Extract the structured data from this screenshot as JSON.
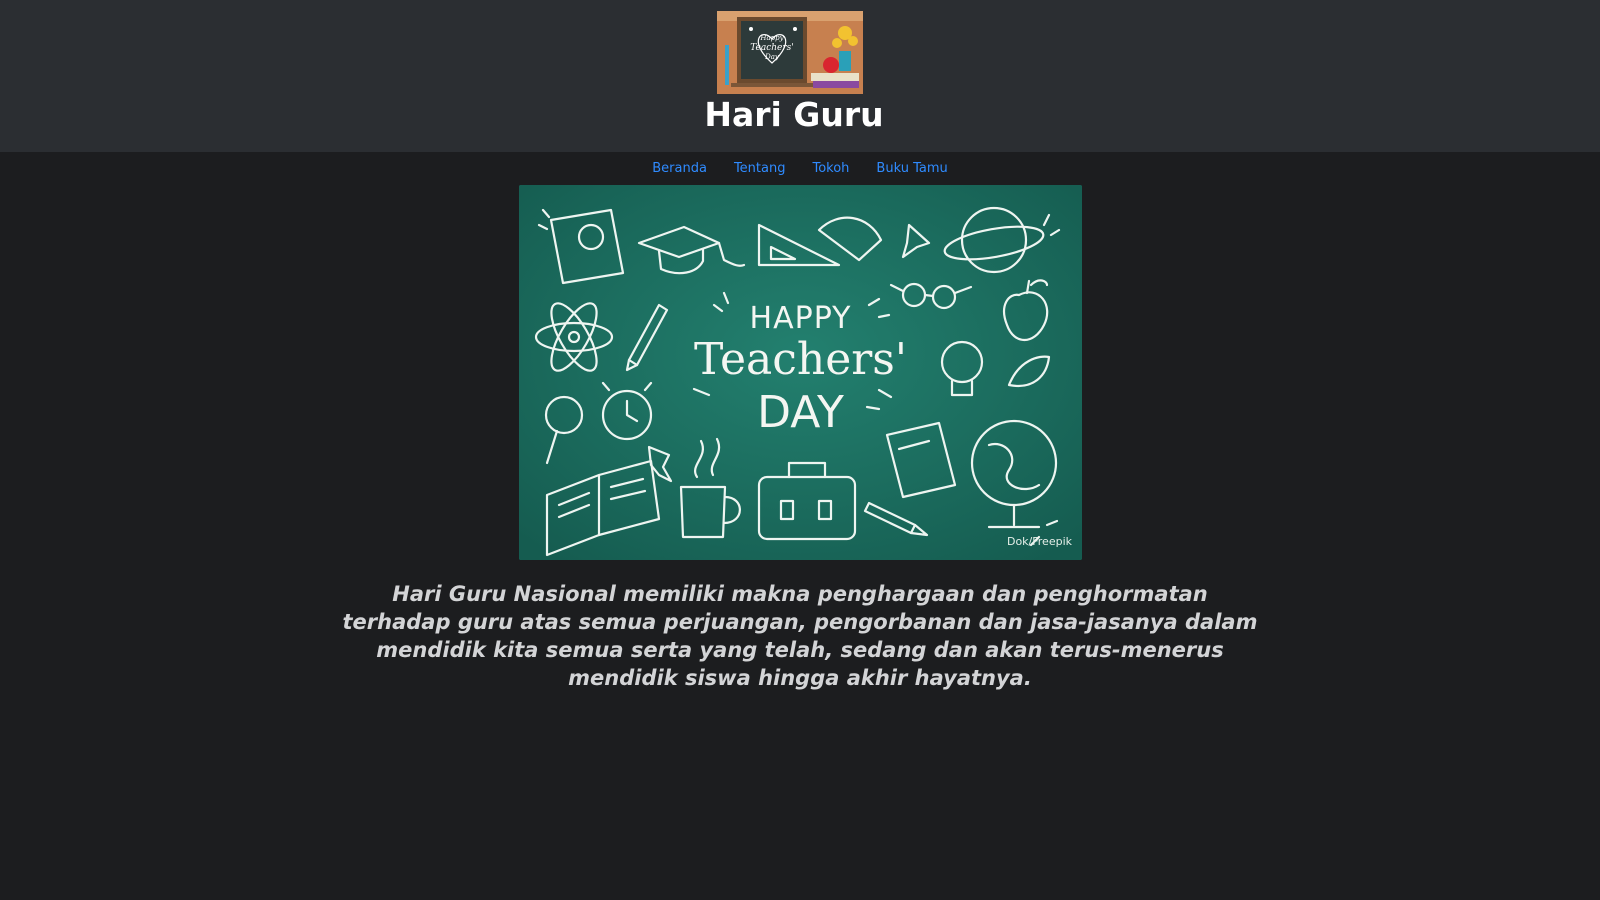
{
  "header": {
    "logo": {
      "icon": "teachers-day-chalkboard-logo",
      "lettering": [
        "Happy",
        "Teachers'",
        "Day"
      ]
    },
    "title": "Hari Guru"
  },
  "nav": {
    "items": [
      {
        "label": "Beranda"
      },
      {
        "label": "Tentang"
      },
      {
        "label": "Tokoh"
      },
      {
        "label": "Buku Tamu"
      }
    ]
  },
  "hero": {
    "line1": "HAPPY",
    "line2": "Teachers'",
    "line3": "DAY",
    "credit": "Dok/Freepik"
  },
  "main": {
    "quote": "Hari Guru Nasional memiliki makna penghargaan dan penghormatan terhadap guru atas semua perjuangan, pengorbanan dan jasa-jasanya dalam mendidik kita semua serta yang telah, sedang dan akan terus-menerus mendidik siswa hingga akhir hayatnya."
  },
  "colors": {
    "header_bg": "#2b2e32",
    "page_bg": "#1c1d1f",
    "link": "#2f8bff",
    "chalkboard": "#1b6b5e"
  }
}
